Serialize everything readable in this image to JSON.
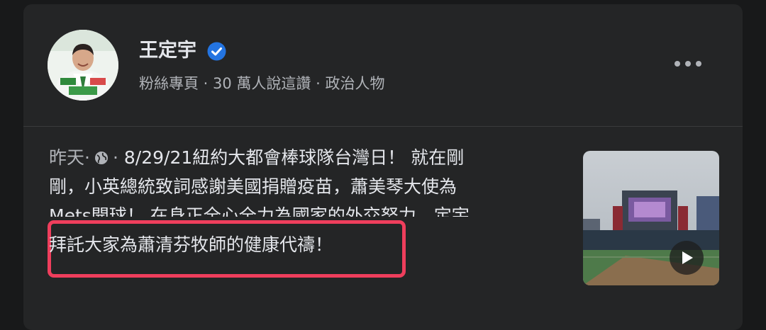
{
  "post": {
    "page_name": "王定宇",
    "page_meta": "粉絲專頁 · 30 萬人說這讚 · 政治人物",
    "timestamp": "昨天",
    "separator": "·",
    "line1": "8/29/21紐約大都會棒球隊台灣日！ 就在剛",
    "line2": "剛，小英總統致詞感謝美國捐贈疫苗，蕭美琴大使為",
    "line3": "Mets開球！ 在身正全心全力為國家的外交努力，定宇",
    "highlighted_line": "拜託大家為蕭清芬牧師的健康代禱！"
  },
  "icons": {
    "verified": "verified-badge-icon",
    "privacy": "globe-icon",
    "more": "more-options-icon",
    "play": "play-icon"
  },
  "colors": {
    "background": "#18191a",
    "card": "#242526",
    "text_primary": "#e4e6eb",
    "text_secondary": "#b0b3b8",
    "verified_blue": "#2374e1",
    "highlight_border": "#ef3e5c"
  }
}
